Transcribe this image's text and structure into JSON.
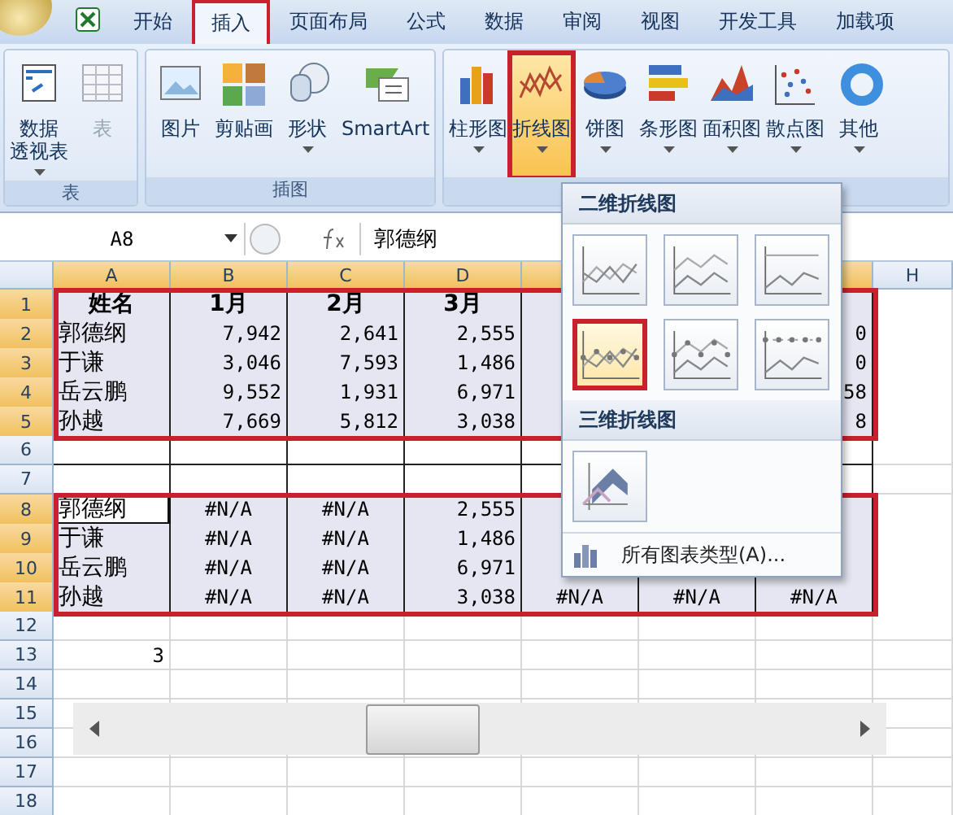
{
  "tabs": [
    {
      "label": "开始",
      "selected": false
    },
    {
      "label": "插入",
      "selected": true
    },
    {
      "label": "页面布局",
      "selected": false
    },
    {
      "label": "公式",
      "selected": false
    },
    {
      "label": "数据",
      "selected": false
    },
    {
      "label": "审阅",
      "selected": false
    },
    {
      "label": "视图",
      "selected": false
    },
    {
      "label": "开发工具",
      "selected": false
    },
    {
      "label": "加载项",
      "selected": false
    }
  ],
  "ribbon": {
    "groups": [
      {
        "label": "表",
        "buttons": [
          {
            "kind": "pivot",
            "lines": [
              "数据",
              "透视表"
            ],
            "dropdown": true,
            "disabled": false,
            "pressed": false
          },
          {
            "kind": "table",
            "lines": [
              "表"
            ],
            "dropdown": false,
            "disabled": true,
            "pressed": false
          }
        ]
      },
      {
        "label": "插图",
        "buttons": [
          {
            "kind": "picture",
            "lines": [
              "图片"
            ],
            "dropdown": false,
            "disabled": false,
            "pressed": false
          },
          {
            "kind": "clipart",
            "lines": [
              "剪贴画"
            ],
            "dropdown": false,
            "disabled": false,
            "pressed": false
          },
          {
            "kind": "shapes",
            "lines": [
              "形状"
            ],
            "dropdown": true,
            "disabled": false,
            "pressed": false
          },
          {
            "kind": "smartart",
            "lines": [
              "SmartArt"
            ],
            "dropdown": false,
            "disabled": false,
            "pressed": false
          }
        ]
      },
      {
        "buttons": [
          {
            "kind": "column",
            "lines": [
              "柱形图"
            ],
            "dropdown": true,
            "disabled": false,
            "pressed": false
          },
          {
            "kind": "line",
            "lines": [
              "折线图"
            ],
            "dropdown": true,
            "disabled": false,
            "pressed": true
          },
          {
            "kind": "pie",
            "lines": [
              "饼图"
            ],
            "dropdown": true,
            "disabled": false,
            "pressed": false
          },
          {
            "kind": "bar",
            "lines": [
              "条形图"
            ],
            "dropdown": true,
            "disabled": false,
            "pressed": false
          },
          {
            "kind": "area",
            "lines": [
              "面积图"
            ],
            "dropdown": true,
            "disabled": false,
            "pressed": false
          },
          {
            "kind": "scatter",
            "lines": [
              "散点图"
            ],
            "dropdown": true,
            "disabled": false,
            "pressed": false
          },
          {
            "kind": "other",
            "lines": [
              "其他"
            ],
            "dropdown": true,
            "disabled": false,
            "pressed": false
          }
        ]
      }
    ]
  },
  "name_box": "A8",
  "formula": "郭德纲",
  "columns": [
    {
      "label": "A",
      "selected": true
    },
    {
      "label": "B",
      "selected": true
    },
    {
      "label": "C",
      "selected": true
    },
    {
      "label": "D",
      "selected": true
    },
    {
      "label": "H",
      "selected": false
    }
  ],
  "rows": [
    {
      "header": "1",
      "selected": true,
      "highlighted": true,
      "bordered": true,
      "cells": {
        "A": {
          "kind": "heading",
          "text": "姓名"
        },
        "B": {
          "kind": "heading",
          "text": "1月"
        },
        "C": {
          "kind": "heading",
          "text": "2月"
        },
        "D": {
          "kind": "heading",
          "text": "3月"
        }
      }
    },
    {
      "header": "2",
      "selected": true,
      "highlighted": true,
      "bordered": true,
      "cells": {
        "A": {
          "kind": "text",
          "text": "郭德纲"
        },
        "B": {
          "kind": "number",
          "text": "7,942"
        },
        "C": {
          "kind": "number",
          "text": "2,641"
        },
        "D": {
          "kind": "number",
          "text": "2,555"
        },
        "G": {
          "kind": "number",
          "text": "0"
        }
      }
    },
    {
      "header": "3",
      "selected": true,
      "highlighted": true,
      "bordered": true,
      "cells": {
        "A": {
          "kind": "text",
          "text": "于谦"
        },
        "B": {
          "kind": "number",
          "text": "3,046"
        },
        "C": {
          "kind": "number",
          "text": "7,593"
        },
        "D": {
          "kind": "number",
          "text": "1,486"
        },
        "G": {
          "kind": "number",
          "text": "0"
        }
      }
    },
    {
      "header": "4",
      "selected": true,
      "highlighted": true,
      "bordered": true,
      "cells": {
        "A": {
          "kind": "text",
          "text": "岳云鹏"
        },
        "B": {
          "kind": "number",
          "text": "9,552"
        },
        "C": {
          "kind": "number",
          "text": "1,931"
        },
        "D": {
          "kind": "number",
          "text": "6,971"
        },
        "G": {
          "kind": "number",
          "text": "58"
        }
      }
    },
    {
      "header": "5",
      "selected": true,
      "highlighted": true,
      "bordered": true,
      "cells": {
        "A": {
          "kind": "text",
          "text": "孙越"
        },
        "B": {
          "kind": "number",
          "text": "7,669"
        },
        "C": {
          "kind": "number",
          "text": "5,812"
        },
        "D": {
          "kind": "number",
          "text": "3,038"
        },
        "G": {
          "kind": "number",
          "text": "8"
        }
      }
    },
    {
      "header": "6",
      "selected": false,
      "highlighted": false,
      "bordered": true,
      "cells": {}
    },
    {
      "header": "7",
      "selected": false,
      "highlighted": false,
      "bordered": true,
      "cells": {}
    },
    {
      "header": "8",
      "selected": true,
      "highlighted": true,
      "bordered": true,
      "cells": {
        "A": {
          "kind": "text",
          "text": "郭德纲",
          "active": true
        },
        "B": {
          "kind": "error",
          "text": "#N/A"
        },
        "C": {
          "kind": "error",
          "text": "#N/A"
        },
        "D": {
          "kind": "number",
          "text": "2,555"
        }
      }
    },
    {
      "header": "9",
      "selected": true,
      "highlighted": true,
      "bordered": true,
      "cells": {
        "A": {
          "kind": "text",
          "text": "于谦"
        },
        "B": {
          "kind": "error",
          "text": "#N/A"
        },
        "C": {
          "kind": "error",
          "text": "#N/A"
        },
        "D": {
          "kind": "number",
          "text": "1,486"
        }
      }
    },
    {
      "header": "10",
      "selected": true,
      "highlighted": true,
      "bordered": true,
      "cells": {
        "A": {
          "kind": "text",
          "text": "岳云鹏"
        },
        "B": {
          "kind": "error",
          "text": "#N/A"
        },
        "C": {
          "kind": "error",
          "text": "#N/A"
        },
        "D": {
          "kind": "number",
          "text": "6,971"
        }
      }
    },
    {
      "header": "11",
      "selected": true,
      "highlighted": true,
      "bordered": true,
      "cells": {
        "A": {
          "kind": "text",
          "text": "孙越"
        },
        "B": {
          "kind": "error",
          "text": "#N/A"
        },
        "C": {
          "kind": "error",
          "text": "#N/A"
        },
        "D": {
          "kind": "number",
          "text": "3,038"
        },
        "E": {
          "kind": "error",
          "text": "#N/A"
        },
        "F": {
          "kind": "error",
          "text": "#N/A"
        },
        "G": {
          "kind": "error",
          "text": "#N/A"
        }
      }
    },
    {
      "header": "12",
      "selected": false,
      "highlighted": false,
      "bordered": false,
      "cells": {}
    },
    {
      "header": "13",
      "selected": false,
      "highlighted": false,
      "bordered": false,
      "cells": {
        "A": {
          "kind": "number",
          "text": "3"
        }
      }
    },
    {
      "header": "14",
      "selected": false,
      "highlighted": false,
      "bordered": false,
      "cells": {}
    },
    {
      "header": "15",
      "selected": false,
      "highlighted": false,
      "bordered": false,
      "cells": {}
    },
    {
      "header": "16",
      "selected": false,
      "highlighted": false,
      "bordered": false,
      "cells": {}
    },
    {
      "header": "17",
      "selected": false,
      "highlighted": false,
      "bordered": false,
      "cells": {}
    },
    {
      "header": "18",
      "selected": false,
      "highlighted": false,
      "bordered": false,
      "cells": {}
    }
  ],
  "chart_menu": {
    "sections": [
      {
        "title": "二维折线图",
        "items": [
          {
            "kind": "line",
            "selected": false
          },
          {
            "kind": "stacked",
            "selected": false
          },
          {
            "kind": "percent",
            "selected": false
          },
          {
            "kind": "line-markers",
            "selected": true
          },
          {
            "kind": "stacked-markers",
            "selected": false
          },
          {
            "kind": "percent-markers",
            "selected": false
          }
        ]
      },
      {
        "title": "三维折线图",
        "items": [
          {
            "kind": "line-3d",
            "selected": false
          }
        ]
      }
    ],
    "footer": "所有图表类型(A)..."
  }
}
